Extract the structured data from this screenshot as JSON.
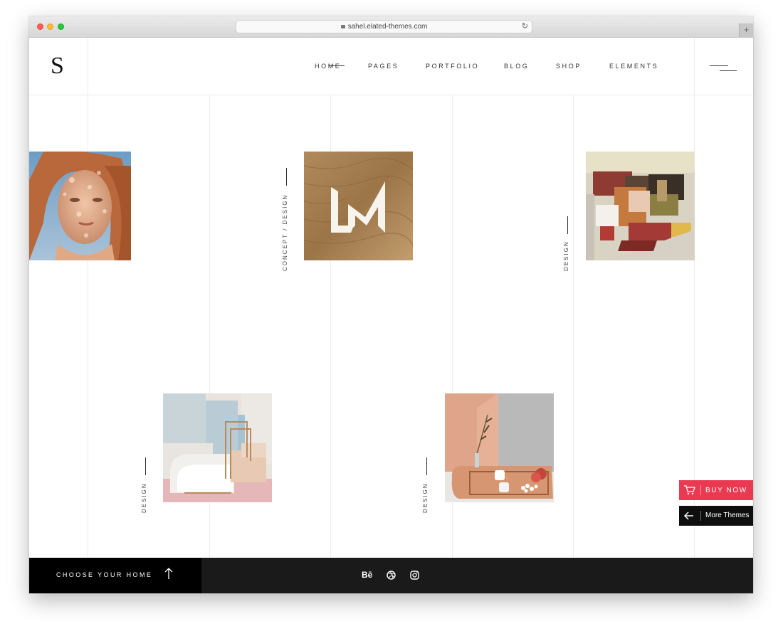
{
  "browser": {
    "url": "sahel.elated-themes.com",
    "new_tab_icon": "plus-icon"
  },
  "site": {
    "logo": "S",
    "nav": [
      {
        "label": "HOME",
        "active": true
      },
      {
        "label": "PAGES",
        "active": false
      },
      {
        "label": "PORTFOLIO",
        "active": false
      },
      {
        "label": "BLOG",
        "active": false
      },
      {
        "label": "SHOP",
        "active": false
      },
      {
        "label": "ELEMENTS",
        "active": false
      }
    ],
    "menu_icon": "hamburger-icon"
  },
  "portfolio": [
    {
      "name": "portrait",
      "tag": ""
    },
    {
      "name": "lm-logo",
      "tag": "CONCEPT / DESIGN"
    },
    {
      "name": "color-blocks",
      "tag": "DESIGN"
    },
    {
      "name": "pastel-stairs",
      "tag": "DESIGN"
    },
    {
      "name": "tray-still-life",
      "tag": "DESIGN"
    }
  ],
  "footer": {
    "choose_label": "CHOOSE YOUR HOME",
    "social": [
      {
        "label": "Bē",
        "icon": "behance-icon"
      },
      {
        "label": "",
        "icon": "dribbble-icon"
      },
      {
        "label": "",
        "icon": "instagram-icon"
      }
    ]
  },
  "floating": {
    "buy_label": "BUY NOW",
    "more_label": "More Themes"
  },
  "colors": {
    "accent": "#ea3a52",
    "dark": "#1a1a1a"
  }
}
